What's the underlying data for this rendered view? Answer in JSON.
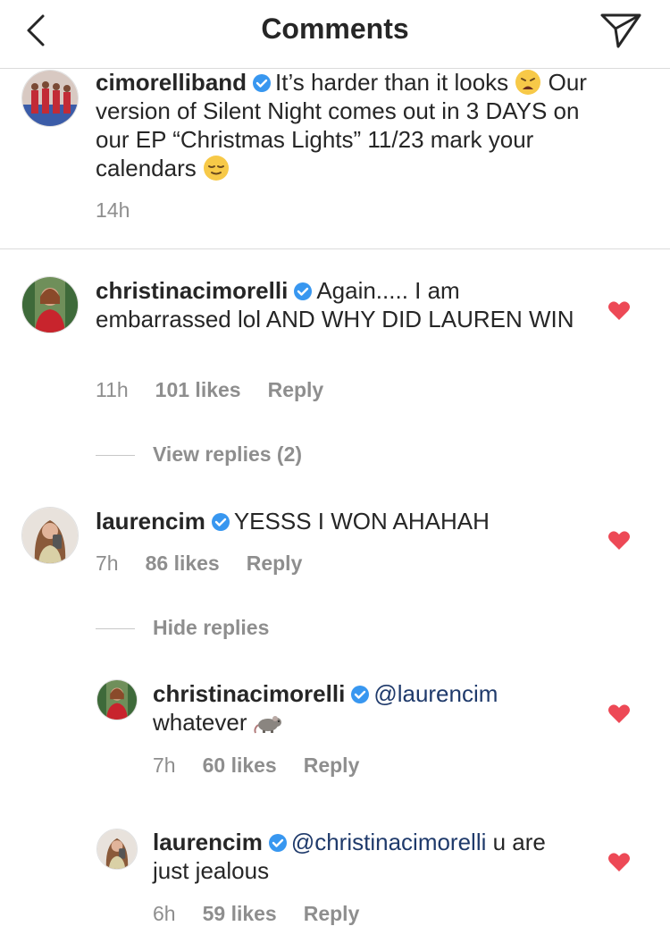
{
  "header": {
    "title": "Comments"
  },
  "caption": {
    "username": "cimorelliband",
    "text_1": "It’s harder than it looks",
    "text_2": "Our version of Silent Night comes out in 3 DAYS on our EP “Christmas Lights” 11/23 mark your calendars",
    "time": "14h"
  },
  "comments": [
    {
      "username": "christinacimorelli",
      "text": "Again..... I am embarrassed lol AND WHY DID LAUREN WIN",
      "time": "11h",
      "likes": "101 likes",
      "reply_label": "Reply",
      "toggle_label": "View replies (2)"
    },
    {
      "username": "laurencim",
      "text": "YESSS I WON AHAHAH",
      "time": "7h",
      "likes": "86 likes",
      "reply_label": "Reply",
      "toggle_label": "Hide replies",
      "replies": [
        {
          "username": "christinacimorelli",
          "mention": "@laurencim",
          "text": "whatever",
          "time": "7h",
          "likes": "60 likes",
          "reply_label": "Reply"
        },
        {
          "username": "laurencim",
          "mention": "@christinacimorelli",
          "text": "u are just jealous",
          "time": "6h",
          "likes": "59 likes",
          "reply_label": "Reply"
        }
      ]
    }
  ],
  "colors": {
    "heart": "#ed4956",
    "verified": "#3897f0",
    "meta": "#8e8e8e",
    "mention": "#1f3a6b"
  }
}
